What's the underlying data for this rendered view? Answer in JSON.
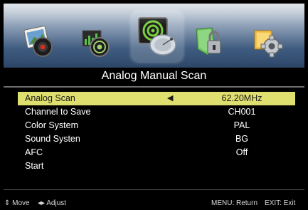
{
  "menu_icons": [
    {
      "name": "picture-menu-icon",
      "selected": false
    },
    {
      "name": "sound-menu-icon",
      "selected": false
    },
    {
      "name": "channel-menu-icon",
      "selected": true
    },
    {
      "name": "lock-menu-icon",
      "selected": false
    },
    {
      "name": "setup-menu-icon",
      "selected": false
    }
  ],
  "title": "Analog Manual Scan",
  "rows": [
    {
      "label": "Analog Scan",
      "value": "62.20MHz",
      "arrow": "◀",
      "highlighted": true
    },
    {
      "label": "Channel to Save",
      "value": "CH001"
    },
    {
      "label": "Color System",
      "value": "PAL"
    },
    {
      "label": "Sound Systen",
      "value": "BG"
    },
    {
      "label": "AFC",
      "value": "Off"
    },
    {
      "label": "Start",
      "value": ""
    }
  ],
  "footer": {
    "move": "⇕ Move",
    "adjust": "◂▸ Adjust",
    "return": "MENU: Return",
    "exit": "EXIT: Exit"
  },
  "colors": {
    "highlight": "#dfdf6f",
    "background": "#000000"
  }
}
